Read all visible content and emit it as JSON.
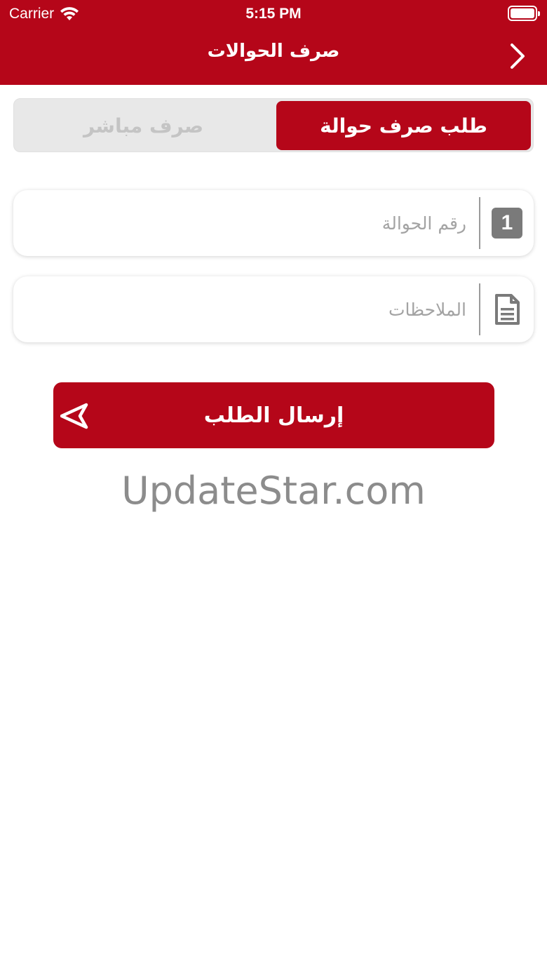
{
  "status_bar": {
    "carrier": "Carrier",
    "time": "5:15 PM"
  },
  "nav": {
    "title": "صرف الحوالات",
    "back_icon": "chevron-right-icon"
  },
  "tabs": [
    {
      "label": "طلب صرف حوالة",
      "active": true
    },
    {
      "label": "صرف مباشر",
      "active": false
    }
  ],
  "form": {
    "transfer_number": {
      "placeholder": "رقم الحوالة",
      "value": "",
      "icon": "number-one-icon",
      "icon_text": "1"
    },
    "notes": {
      "placeholder": "الملاحظات",
      "value": "",
      "icon": "document-icon"
    }
  },
  "submit": {
    "label": "إرسال الطلب",
    "icon": "send-icon"
  },
  "watermark": "UpdateStar.com",
  "colors": {
    "brand": "#b50619",
    "segment_bg": "#e8e8e8",
    "placeholder": "#a3a3a3",
    "icon_gray": "#7a7a7a"
  }
}
